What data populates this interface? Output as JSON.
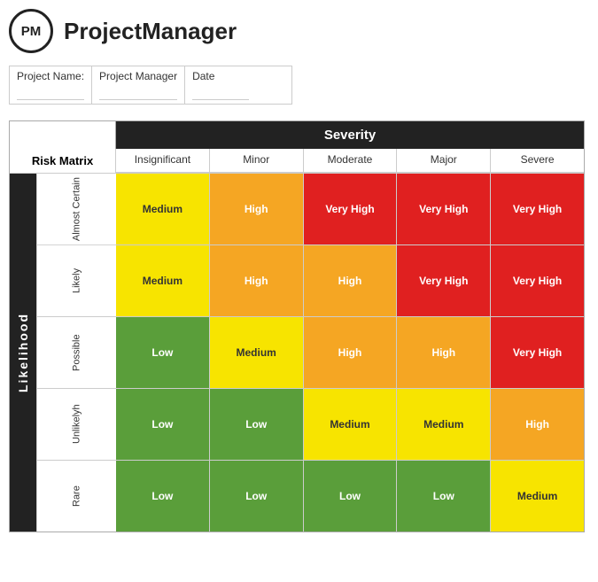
{
  "header": {
    "logo_text": "PM",
    "app_title": "ProjectManager"
  },
  "project_info": {
    "name_label": "Project Name:",
    "manager_label": "Project Manager",
    "date_label": "Date"
  },
  "matrix": {
    "severity_label": "Severity",
    "likelihood_label": "Likelihood",
    "col_headers": [
      "Insignificant",
      "Minor",
      "Moderate",
      "Major",
      "Severe"
    ],
    "rows": [
      {
        "label": "Almost Certain",
        "cells": [
          {
            "text": "Medium",
            "class": "risk-medium"
          },
          {
            "text": "High",
            "class": "risk-high"
          },
          {
            "text": "Very High",
            "class": "risk-very-high"
          },
          {
            "text": "Very High",
            "class": "risk-very-high"
          },
          {
            "text": "Very High",
            "class": "risk-very-high"
          }
        ]
      },
      {
        "label": "Likely",
        "cells": [
          {
            "text": "Medium",
            "class": "risk-medium"
          },
          {
            "text": "High",
            "class": "risk-high"
          },
          {
            "text": "High",
            "class": "risk-high"
          },
          {
            "text": "Very High",
            "class": "risk-very-high"
          },
          {
            "text": "Very High",
            "class": "risk-very-high"
          }
        ]
      },
      {
        "label": "Possible",
        "cells": [
          {
            "text": "Low",
            "class": "risk-low"
          },
          {
            "text": "Medium",
            "class": "risk-medium"
          },
          {
            "text": "High",
            "class": "risk-high"
          },
          {
            "text": "High",
            "class": "risk-high"
          },
          {
            "text": "Very High",
            "class": "risk-very-high"
          }
        ]
      },
      {
        "label": "Unlikelyh",
        "cells": [
          {
            "text": "Low",
            "class": "risk-low"
          },
          {
            "text": "Low",
            "class": "risk-low"
          },
          {
            "text": "Medium",
            "class": "risk-medium"
          },
          {
            "text": "Medium",
            "class": "risk-medium"
          },
          {
            "text": "High",
            "class": "risk-high"
          }
        ]
      },
      {
        "label": "Rare",
        "cells": [
          {
            "text": "Low",
            "class": "risk-low"
          },
          {
            "text": "Low",
            "class": "risk-low"
          },
          {
            "text": "Low",
            "class": "risk-low"
          },
          {
            "text": "Low",
            "class": "risk-low"
          },
          {
            "text": "Medium",
            "class": "risk-medium"
          }
        ]
      }
    ]
  }
}
